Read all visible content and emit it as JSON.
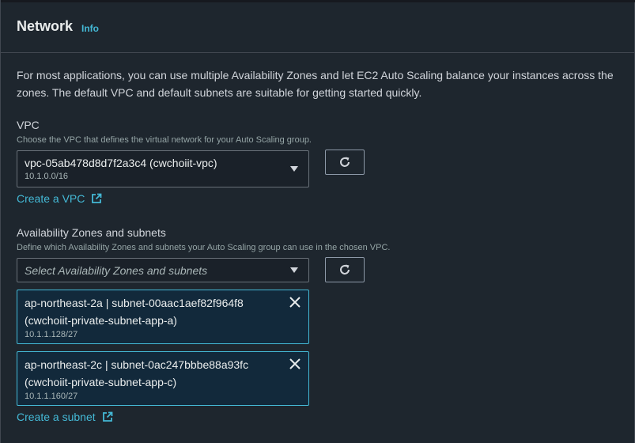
{
  "section": {
    "title": "Network",
    "info_link": "Info",
    "description": "For most applications, you can use multiple Availability Zones and let EC2 Auto Scaling balance your instances across the zones. The default VPC and default subnets are suitable for getting started quickly."
  },
  "vpc": {
    "label": "VPC",
    "description": "Choose the VPC that defines the virtual network for your Auto Scaling group.",
    "selected_value": "vpc-05ab478d8d7f2a3c4 (cwchoiit-vpc)",
    "selected_cidr": "10.1.0.0/16",
    "create_link": "Create a VPC"
  },
  "subnets": {
    "label": "Availability Zones and subnets",
    "description": "Define which Availability Zones and subnets your Auto Scaling group can use in the chosen VPC.",
    "placeholder": "Select Availability Zones and subnets",
    "selected": [
      {
        "zone_subnet": "ap-northeast-2a | subnet-00aac1aef82f964f8",
        "name": "(cwchoiit-private-subnet-app-a)",
        "cidr": "10.1.1.128/27"
      },
      {
        "zone_subnet": "ap-northeast-2c | subnet-0ac247bbbe88a93fc",
        "name": "(cwchoiit-private-subnet-app-c)",
        "cidr": "10.1.1.160/27"
      }
    ],
    "create_link": "Create a subnet"
  },
  "icons": {
    "refresh": "refresh-icon",
    "external": "external-link-icon",
    "dropdown": "caret-down-icon",
    "remove": "close-icon"
  },
  "colors": {
    "link": "#44b9d6",
    "token_border": "#44b9d6",
    "token_bg": "#12293b"
  }
}
